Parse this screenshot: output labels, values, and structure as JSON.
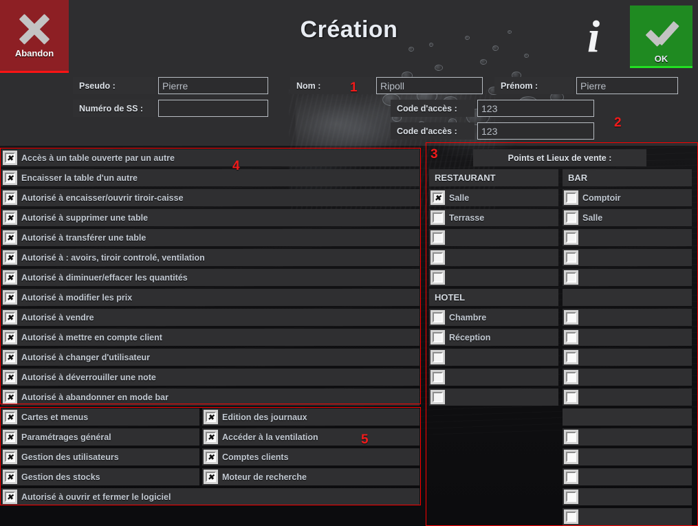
{
  "header": {
    "abandon_label": "Abandon",
    "title": "Création",
    "ok_label": "OK",
    "info_glyph": "i"
  },
  "form": {
    "pseudo_label": "Pseudo :",
    "pseudo_value": "Pierre",
    "ss_label": "Numéro de SS :",
    "ss_value": "",
    "nom_label": "Nom  :",
    "nom_value": "Ripoll",
    "prenom_label": "Prénom :",
    "prenom_value": "Pierre",
    "code1_label": "Code d'accès :",
    "code1_value": "123",
    "code2_label": "Code d'accès :",
    "code2_value": "123"
  },
  "markers": {
    "m1": "1",
    "m2": "2",
    "m3": "3",
    "m4": "4",
    "m5": "5"
  },
  "permissions": [
    {
      "label": "Accès à un table ouverte par un autre",
      "checked": true
    },
    {
      "label": "Encaisser la table d'un autre",
      "checked": true
    },
    {
      "label": "Autorisé à encaisser/ouvrir tiroir-caisse",
      "checked": true
    },
    {
      "label": "Autorisé à supprimer une table",
      "checked": true
    },
    {
      "label": "Autorisé à transférer une table",
      "checked": true
    },
    {
      "label": "Autorisé à : avoirs, tiroir controlé, ventilation",
      "checked": true
    },
    {
      "label": "Autorisé à diminuer/effacer les quantités",
      "checked": true
    },
    {
      "label": "Autorisé à modifier les prix",
      "checked": true
    },
    {
      "label": "Autorisé à vendre",
      "checked": true
    },
    {
      "label": "Autorisé à mettre en compte client",
      "checked": true
    },
    {
      "label": "Autorisé à changer d'utilisateur",
      "checked": true
    },
    {
      "label": "Autorisé à déverrouiller une note",
      "checked": true
    },
    {
      "label": "Autorisé à abandonner en mode bar",
      "checked": true
    }
  ],
  "modules_left": [
    {
      "label": "Cartes et menus",
      "checked": true
    },
    {
      "label": "Paramétrages général",
      "checked": true
    },
    {
      "label": "Gestion des utilisateurs",
      "checked": true
    },
    {
      "label": "Gestion des stocks",
      "checked": true
    }
  ],
  "modules_right": [
    {
      "label": "Edition des journaux",
      "checked": true
    },
    {
      "label": "Accéder à la ventilation",
      "checked": true
    },
    {
      "label": "Comptes clients",
      "checked": true
    },
    {
      "label": "Moteur de recherche",
      "checked": true
    }
  ],
  "modules_full": [
    {
      "label": "Autorisé à ouvrir et fermer le logiciel",
      "checked": true
    }
  ],
  "sales_points": {
    "panel_title": "Points et Lieux de vente :",
    "col1": {
      "group1_header": "RESTAURANT",
      "group1_items": [
        {
          "label": "Salle",
          "checked": true
        },
        {
          "label": "Terrasse",
          "checked": false
        },
        {
          "label": "",
          "checked": false
        },
        {
          "label": "",
          "checked": false
        },
        {
          "label": "",
          "checked": false
        }
      ],
      "group2_header": "HOTEL",
      "group2_items": [
        {
          "label": "Chambre",
          "checked": false
        },
        {
          "label": "Réception",
          "checked": false
        },
        {
          "label": "",
          "checked": false
        },
        {
          "label": "",
          "checked": false
        },
        {
          "label": "",
          "checked": false
        }
      ]
    },
    "col2": {
      "group1_header": "BAR",
      "group1_items": [
        {
          "label": "Comptoir",
          "checked": false
        },
        {
          "label": "Salle",
          "checked": false
        },
        {
          "label": "",
          "checked": false
        },
        {
          "label": "",
          "checked": false
        },
        {
          "label": "",
          "checked": false
        }
      ],
      "group2_header": "",
      "group2_items": [
        {
          "label": "",
          "checked": false
        },
        {
          "label": "",
          "checked": false
        },
        {
          "label": "",
          "checked": false
        },
        {
          "label": "",
          "checked": false
        },
        {
          "label": "",
          "checked": false
        }
      ],
      "group3_header": "",
      "group3_items": [
        {
          "label": "",
          "checked": false
        },
        {
          "label": "",
          "checked": false
        },
        {
          "label": "",
          "checked": false
        },
        {
          "label": "",
          "checked": false
        },
        {
          "label": "",
          "checked": false
        }
      ]
    }
  },
  "colors": {
    "abandon_red": "#8d1f24",
    "ok_green": "#1f8a21",
    "marker_red": "#f21b1b",
    "outline_red": "#ff0000",
    "panel_bg": "#2f2f31"
  }
}
